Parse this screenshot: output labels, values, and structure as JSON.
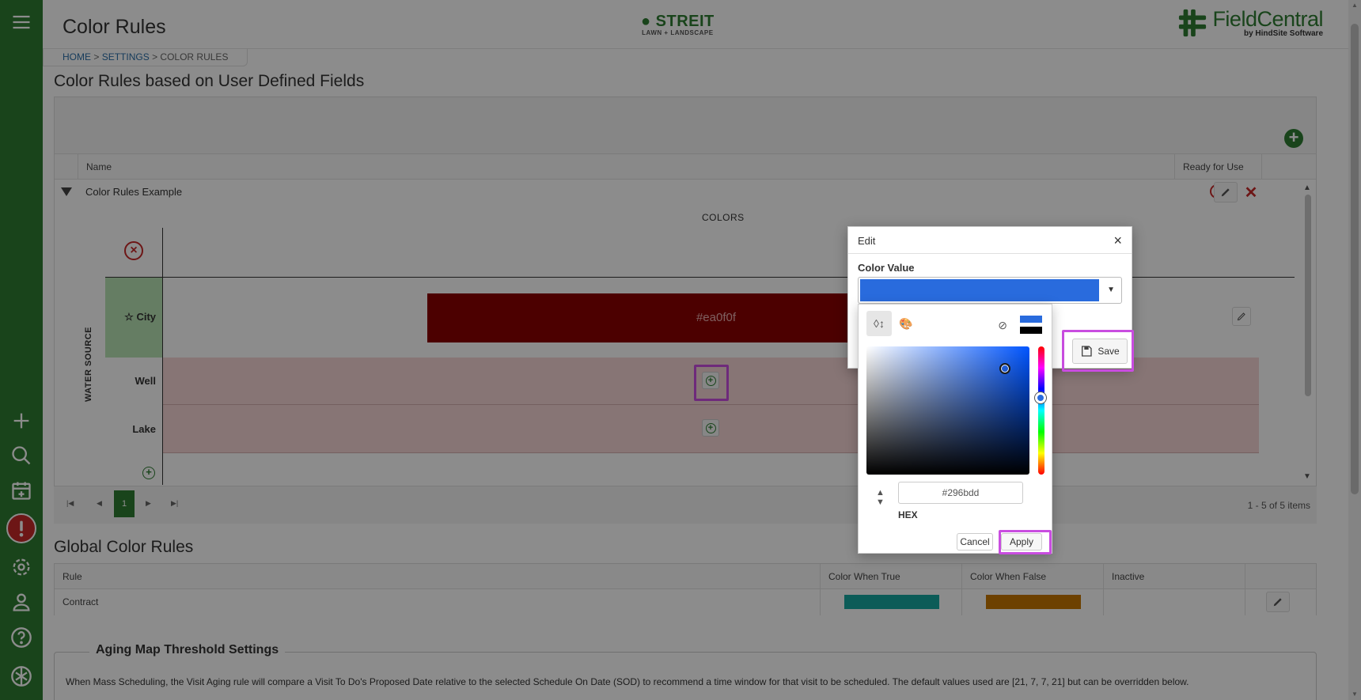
{
  "header": {
    "page_title": "Color Rules",
    "brand_name": "STREIT",
    "brand_tagline": "LAWN + LANDSCAPE",
    "logo_name": "FieldCentral",
    "logo_sub": "by HindSite Software"
  },
  "breadcrumb": {
    "home": "HOME",
    "settings": "SETTINGS",
    "current": "COLOR RULES",
    "sep": ">"
  },
  "sidebar": {
    "items": [
      "menu-icon",
      "plus-icon",
      "search-icon",
      "calendar-add-icon",
      "alert-icon",
      "settings-icon",
      "user-icon",
      "help-icon",
      "logo-icon"
    ]
  },
  "udf_section": {
    "title": "Color Rules based on User Defined Fields",
    "columns": {
      "name": "Name",
      "ready": "Ready for Use"
    },
    "row": {
      "name": "Color Rules Example"
    },
    "inner": {
      "colors_header": "COLORS",
      "axis_label": "WATER SOURCE",
      "rows": [
        "City",
        "Well",
        "Lake"
      ],
      "city_color": "#ea0f0f"
    },
    "pager": {
      "page": "1",
      "info": "1 - 5 of 5 items"
    }
  },
  "global_section": {
    "title": "Global Color Rules",
    "columns": [
      "Rule",
      "Color When True",
      "Color When False",
      "Inactive"
    ],
    "rows": [
      {
        "rule": "Contract",
        "true_color": "#17a8a0",
        "false_color": "#c77700"
      }
    ]
  },
  "aging": {
    "title": "Aging Map Threshold Settings",
    "text": "When Mass Scheduling, the Visit Aging rule will compare a Visit To Do's Proposed Date relative to the selected Schedule On Date (SOD) to recommend a time window for that visit to be scheduled. The default values used are [21, 7, 7, 21] but can be overridden below."
  },
  "dialog": {
    "title": "Edit",
    "close": "×",
    "color_value_label": "Color Value",
    "selected_color": "#296bdd",
    "save_label": "Save"
  },
  "picker": {
    "hex_value": "#296bdd",
    "hex_label": "HEX",
    "cancel_label": "Cancel",
    "apply_label": "Apply"
  }
}
